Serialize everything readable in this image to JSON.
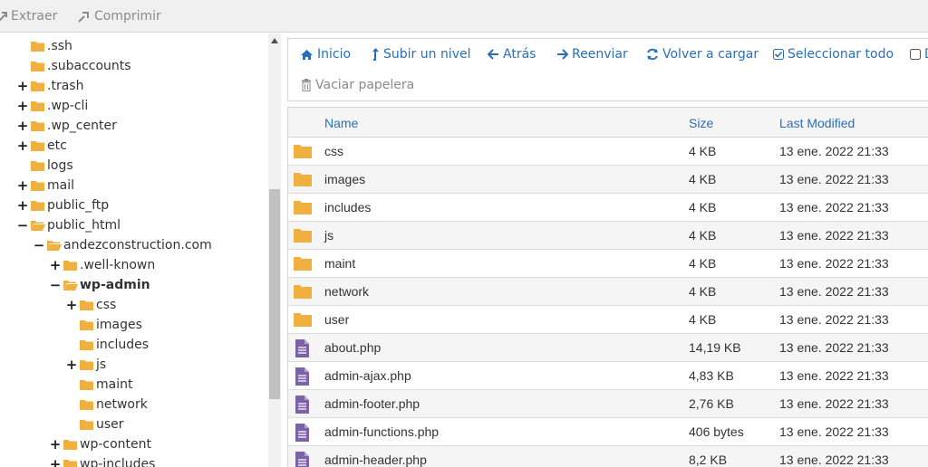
{
  "colors": {
    "folder": "#f0b040",
    "file": "#7b63a8",
    "link": "#2a6ebb",
    "muted": "#8a8a8a"
  },
  "toolbar": {
    "extract_label": "Extraer",
    "compress_label": "Comprimir"
  },
  "actions": {
    "home": "Inicio",
    "up_level": "Subir un nivel",
    "back": "Atrás",
    "forward": "Reenviar",
    "reload": "Volver a cargar",
    "select_all": "Seleccionar todo",
    "deselect_partial": "D",
    "empty_trash": "Vaciar papelera"
  },
  "tree": [
    {
      "label": ".ssh",
      "toggle": "",
      "indent": 0,
      "open": false,
      "bold": false
    },
    {
      "label": ".subaccounts",
      "toggle": "",
      "indent": 0,
      "open": false,
      "bold": false
    },
    {
      "label": ".trash",
      "toggle": "+",
      "indent": 0,
      "open": false,
      "bold": false
    },
    {
      "label": ".wp-cli",
      "toggle": "+",
      "indent": 0,
      "open": false,
      "bold": false
    },
    {
      "label": ".wp_center",
      "toggle": "+",
      "indent": 0,
      "open": false,
      "bold": false
    },
    {
      "label": "etc",
      "toggle": "+",
      "indent": 0,
      "open": false,
      "bold": false
    },
    {
      "label": "logs",
      "toggle": "",
      "indent": 0,
      "open": false,
      "bold": false
    },
    {
      "label": "mail",
      "toggle": "+",
      "indent": 0,
      "open": false,
      "bold": false
    },
    {
      "label": "public_ftp",
      "toggle": "+",
      "indent": 0,
      "open": false,
      "bold": false
    },
    {
      "label": "public_html",
      "toggle": "−",
      "indent": 0,
      "open": true,
      "bold": false
    },
    {
      "label": "andezconstruction.com",
      "toggle": "−",
      "indent": 1,
      "open": true,
      "bold": false
    },
    {
      "label": ".well-known",
      "toggle": "+",
      "indent": 2,
      "open": false,
      "bold": false
    },
    {
      "label": "wp-admin",
      "toggle": "−",
      "indent": 2,
      "open": true,
      "bold": true
    },
    {
      "label": "css",
      "toggle": "+",
      "indent": 3,
      "open": false,
      "bold": false
    },
    {
      "label": "images",
      "toggle": "",
      "indent": 3,
      "open": false,
      "bold": false
    },
    {
      "label": "includes",
      "toggle": "",
      "indent": 3,
      "open": false,
      "bold": false
    },
    {
      "label": "js",
      "toggle": "+",
      "indent": 3,
      "open": false,
      "bold": false
    },
    {
      "label": "maint",
      "toggle": "",
      "indent": 3,
      "open": false,
      "bold": false
    },
    {
      "label": "network",
      "toggle": "",
      "indent": 3,
      "open": false,
      "bold": false
    },
    {
      "label": "user",
      "toggle": "",
      "indent": 3,
      "open": false,
      "bold": false
    },
    {
      "label": "wp-content",
      "toggle": "+",
      "indent": 2,
      "open": false,
      "bold": false
    },
    {
      "label": "wp-includes",
      "toggle": "+",
      "indent": 2,
      "open": false,
      "bold": false
    }
  ],
  "table": {
    "headers": {
      "name": "Name",
      "size": "Size",
      "modified": "Last Modified"
    },
    "rows": [
      {
        "type": "folder",
        "name": "css",
        "size": "4 KB",
        "modified": "13 ene. 2022 21:33"
      },
      {
        "type": "folder",
        "name": "images",
        "size": "4 KB",
        "modified": "13 ene. 2022 21:33"
      },
      {
        "type": "folder",
        "name": "includes",
        "size": "4 KB",
        "modified": "13 ene. 2022 21:33"
      },
      {
        "type": "folder",
        "name": "js",
        "size": "4 KB",
        "modified": "13 ene. 2022 21:33"
      },
      {
        "type": "folder",
        "name": "maint",
        "size": "4 KB",
        "modified": "13 ene. 2022 21:33"
      },
      {
        "type": "folder",
        "name": "network",
        "size": "4 KB",
        "modified": "13 ene. 2022 21:33"
      },
      {
        "type": "folder",
        "name": "user",
        "size": "4 KB",
        "modified": "13 ene. 2022 21:33"
      },
      {
        "type": "file",
        "name": "about.php",
        "size": "14,19 KB",
        "modified": "13 ene. 2022 21:33"
      },
      {
        "type": "file",
        "name": "admin-ajax.php",
        "size": "4,83 KB",
        "modified": "13 ene. 2022 21:33"
      },
      {
        "type": "file",
        "name": "admin-footer.php",
        "size": "2,76 KB",
        "modified": "13 ene. 2022 21:33"
      },
      {
        "type": "file",
        "name": "admin-functions.php",
        "size": "406 bytes",
        "modified": "13 ene. 2022 21:33"
      },
      {
        "type": "file",
        "name": "admin-header.php",
        "size": "8,2 KB",
        "modified": "13 ene. 2022 21:33"
      }
    ]
  }
}
